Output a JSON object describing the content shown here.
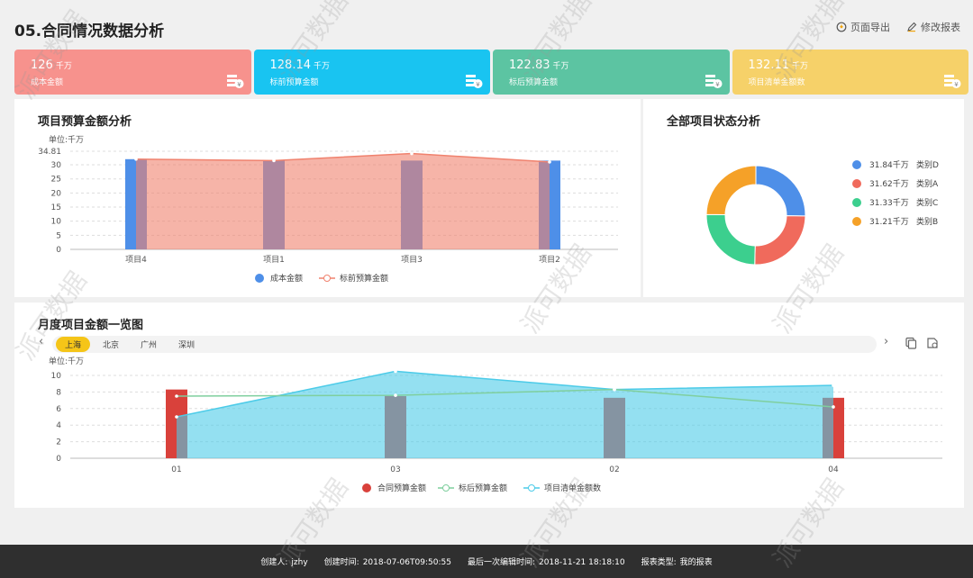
{
  "header": {
    "title": "05.合同情况数据分析",
    "export_label": "页面导出",
    "edit_label": "修改报表"
  },
  "kpis": [
    {
      "value": "126",
      "unit": "千万",
      "label": "成本金额",
      "color": "#f7928d"
    },
    {
      "value": "128.14",
      "unit": "千万",
      "label": "标前预算金额",
      "color": "#19c4f1"
    },
    {
      "value": "122.83",
      "unit": "千万",
      "label": "标后预算金额",
      "color": "#5cc4a2"
    },
    {
      "value": "132.11",
      "unit": "千万",
      "label": "项目清单金额数",
      "color": "#f6d169"
    }
  ],
  "panel1": {
    "title": "项目预算金额分析",
    "unit_label": "单位:千万",
    "legend": [
      "成本金额",
      "标前预算金额"
    ]
  },
  "panel2": {
    "title": "全部项目状态分析",
    "items": [
      {
        "value": "31.84千万",
        "name": "类别D",
        "color": "#4e8fe8"
      },
      {
        "value": "31.62千万",
        "name": "类别A",
        "color": "#f06a5c"
      },
      {
        "value": "31.33千万",
        "name": "类别C",
        "color": "#3ccf8e"
      },
      {
        "value": "31.21千万",
        "name": "类别B",
        "color": "#f5a128"
      }
    ]
  },
  "panel3": {
    "title": "月度项目金额一览图",
    "tabs": [
      "上海",
      "北京",
      "广州",
      "深圳"
    ],
    "active_tab": 0,
    "unit_label": "单位:千万",
    "legend": [
      "合同预算金额",
      "标后预算金额",
      "项目清单金额数"
    ]
  },
  "chart_data": [
    {
      "type": "bar",
      "title": "项目预算金额分析",
      "ylabel": "单位:千万",
      "categories": [
        "项目4",
        "项目1",
        "项目3",
        "项目2"
      ],
      "ylim": [
        0,
        34.81
      ],
      "yticks": [
        "0",
        "5",
        "10",
        "15",
        "20",
        "25",
        "30",
        "34.81"
      ],
      "series": [
        {
          "name": "成本金额",
          "type": "bar",
          "color": "#4e8fe8",
          "values": [
            32,
            31.5,
            31.5,
            31.5
          ]
        },
        {
          "name": "标前预算金额",
          "type": "area",
          "color": "#f0826e",
          "values": [
            32,
            31.5,
            34,
            31
          ]
        }
      ]
    },
    {
      "type": "pie",
      "title": "全部项目状态分析",
      "categories": [
        "类别D",
        "类别A",
        "类别C",
        "类别B"
      ],
      "values": [
        31.84,
        31.62,
        31.33,
        31.21
      ],
      "colors": [
        "#4e8fe8",
        "#f06a5c",
        "#3ccf8e",
        "#f5a128"
      ]
    },
    {
      "type": "bar",
      "title": "月度项目金额一览图",
      "ylabel": "单位:千万",
      "categories": [
        "01",
        "03",
        "02",
        "04"
      ],
      "ylim": [
        0,
        10
      ],
      "yticks": [
        "0",
        "2",
        "4",
        "6",
        "8",
        "10"
      ],
      "series": [
        {
          "name": "合同预算金额",
          "type": "bar",
          "color": "#d9413b",
          "values": [
            8.3,
            7.5,
            7.3,
            7.3
          ]
        },
        {
          "name": "标后预算金额",
          "type": "line",
          "color": "#7fcf9e",
          "values": [
            7.5,
            7.6,
            8.3,
            6.2
          ]
        },
        {
          "name": "项目清单金额数",
          "type": "area",
          "color": "#4ccbe8",
          "values": [
            5,
            10.5,
            8.3,
            8.8
          ]
        }
      ]
    }
  ],
  "footer": {
    "creator_label": "创建人:",
    "creator": "jzhy",
    "created_label": "创建时间:",
    "created": "2018-07-06T09:50:55",
    "edited_label": "最后一次编辑时间:",
    "edited": "2018-11-21 18:18:10",
    "type_label": "报表类型:",
    "type": "我的报表"
  },
  "watermark": "派可数据"
}
